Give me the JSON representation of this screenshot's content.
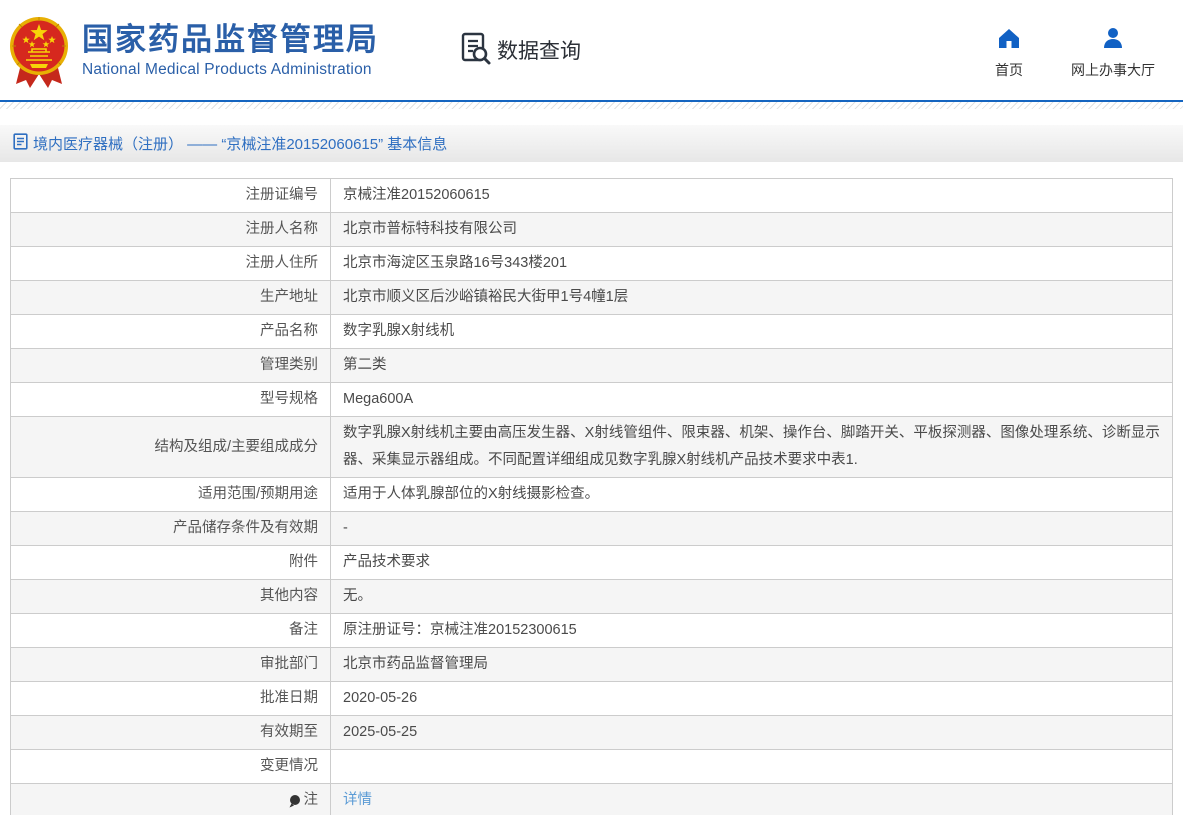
{
  "header": {
    "title": "国家药品监督管理局",
    "subtitle": "National Medical Products Administration",
    "search_label": "数据查询",
    "nav": [
      {
        "label": "首页",
        "icon": "home-icon"
      },
      {
        "label": "网上办事大厅",
        "icon": "user-icon"
      }
    ]
  },
  "breadcrumb": {
    "text": "境内医疗器械（注册） —— “京械注准20152060615” 基本信息"
  },
  "table": {
    "rows": [
      {
        "label": "注册证编号",
        "value": "京械注准20152060615"
      },
      {
        "label": "注册人名称",
        "value": "北京市普标特科技有限公司"
      },
      {
        "label": "注册人住所",
        "value": "北京市海淀区玉泉路16号343楼201"
      },
      {
        "label": "生产地址",
        "value": "北京市顺义区后沙峪镇裕民大街甲1号4幢1层"
      },
      {
        "label": "产品名称",
        "value": "数字乳腺X射线机"
      },
      {
        "label": "管理类别",
        "value": "第二类"
      },
      {
        "label": "型号规格",
        "value": "Mega600A"
      },
      {
        "label": "结构及组成/主要组成成分",
        "value": "数字乳腺X射线机主要由高压发生器、X射线管组件、限束器、机架、操作台、脚踏开关、平板探测器、图像处理系统、诊断显示器、采集显示器组成。不同配置详细组成见数字乳腺X射线机产品技术要求中表1."
      },
      {
        "label": "适用范围/预期用途",
        "value": "适用于人体乳腺部位的X射线摄影检查。"
      },
      {
        "label": "产品储存条件及有效期",
        "value": "-"
      },
      {
        "label": "附件",
        "value": "产品技术要求"
      },
      {
        "label": "其他内容",
        "value": "无。"
      },
      {
        "label": "备注",
        "value": "原注册证号：京械注准20152300615"
      },
      {
        "label": "审批部门",
        "value": "北京市药品监督管理局"
      },
      {
        "label": "批准日期",
        "value": "2020-05-26"
      },
      {
        "label": "有效期至",
        "value": "2025-05-25"
      },
      {
        "label": "变更情况",
        "value": ""
      },
      {
        "label": "注",
        "label_icon": "bulb-icon",
        "value": "详情",
        "is_link": true
      }
    ]
  },
  "colors": {
    "brand_blue": "#2a5fa8",
    "line_blue": "#1565c0",
    "link_blue": "#5b9bd5",
    "crumb_blue": "#2f6fc1",
    "row_alt_bg": "#f5f5f5",
    "border": "#cccccc"
  }
}
